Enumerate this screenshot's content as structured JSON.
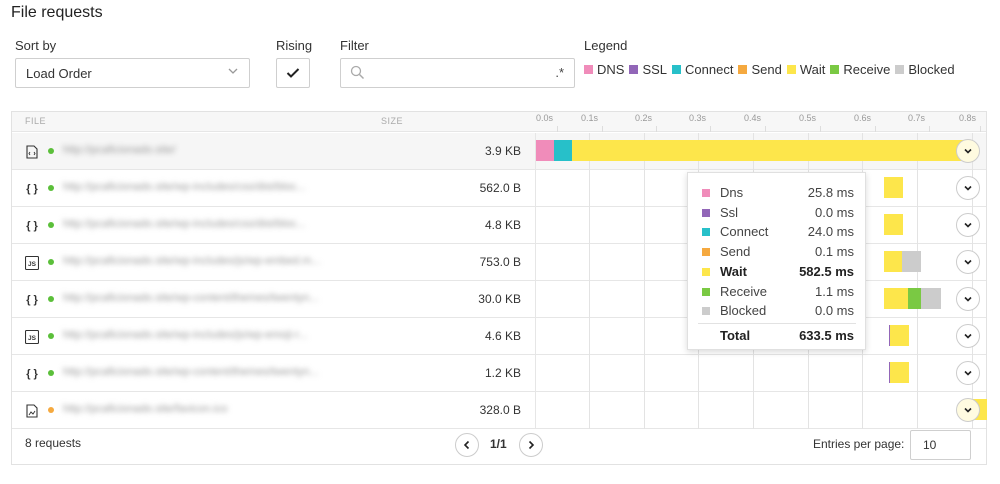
{
  "title": "File requests",
  "sort": {
    "label": "Sort by",
    "value": "Load Order"
  },
  "rising": {
    "label": "Rising",
    "checked": true
  },
  "filter": {
    "label": "Filter",
    "placeholder": "",
    "regex_label": ".*"
  },
  "legend": {
    "label": "Legend",
    "items": [
      {
        "name": "DNS",
        "color": "#f08cba"
      },
      {
        "name": "SSL",
        "color": "#9266b8"
      },
      {
        "name": "Connect",
        "color": "#27c0c9"
      },
      {
        "name": "Send",
        "color": "#f5a93f"
      },
      {
        "name": "Wait",
        "color": "#fde64b"
      },
      {
        "name": "Receive",
        "color": "#7ac943"
      },
      {
        "name": "Blocked",
        "color": "#cccccc"
      }
    ]
  },
  "table": {
    "columns": {
      "file": "FILE",
      "size": "SIZE"
    },
    "ticks": [
      "0.0s",
      "0.1s",
      "0.2s",
      "0.3s",
      "0.4s",
      "0.5s",
      "0.6s",
      "0.7s",
      "0.8s"
    ],
    "rows": [
      {
        "type": "html",
        "type_glyph": "</>",
        "status_color": "#5bbf3a",
        "url": "http://pcaficionado.site/",
        "size": "3.9 KB"
      },
      {
        "type": "css",
        "type_glyph": "{ }",
        "status_color": "#5bbf3a",
        "url": "http://pcaficionado.site/wp-includes/css/dist/bloc...",
        "size": "562.0 B"
      },
      {
        "type": "css",
        "type_glyph": "{ }",
        "status_color": "#5bbf3a",
        "url": "http://pcaficionado.site/wp-includes/css/dist/bloc...",
        "size": "4.8 KB"
      },
      {
        "type": "js",
        "type_glyph": "JS",
        "status_color": "#5bbf3a",
        "url": "http://pcaficionado.site/wp-includes/js/wp-embed.m...",
        "size": "753.0 B"
      },
      {
        "type": "css",
        "type_glyph": "{ }",
        "status_color": "#5bbf3a",
        "url": "http://pcaficionado.site/wp-content/themes/twentyn...",
        "size": "30.0 KB"
      },
      {
        "type": "js",
        "type_glyph": "JS",
        "status_color": "#5bbf3a",
        "url": "http://pcaficionado.site/wp-includes/js/wp-emoji-r...",
        "size": "4.6 KB"
      },
      {
        "type": "css",
        "type_glyph": "{ }",
        "status_color": "#5bbf3a",
        "url": "http://pcaficionado.site/wp-content/themes/twentyn...",
        "size": "1.2 KB"
      },
      {
        "type": "image",
        "type_glyph": "img",
        "status_color": "#f5a93f",
        "url": "http://pcaficionado.site/favicon.ico",
        "size": "328.0 B"
      }
    ]
  },
  "tooltip": {
    "items": [
      {
        "name": "Dns",
        "value": "25.8 ms",
        "color": "#f08cba"
      },
      {
        "name": "Ssl",
        "value": "0.0 ms",
        "color": "#9266b8"
      },
      {
        "name": "Connect",
        "value": "24.0 ms",
        "color": "#27c0c9"
      },
      {
        "name": "Send",
        "value": "0.1 ms",
        "color": "#f5a93f"
      },
      {
        "name": "Wait",
        "value": "582.5 ms",
        "color": "#fde64b"
      },
      {
        "name": "Receive",
        "value": "1.1 ms",
        "color": "#7ac943"
      },
      {
        "name": "Blocked",
        "value": "0.0 ms",
        "color": "#cccccc"
      }
    ],
    "total_label": "Total",
    "total_value": "633.5 ms"
  },
  "footer": {
    "count": "8 requests",
    "page": "1/1",
    "per_page_label": "Entries per page:",
    "per_page_value": "10"
  }
}
